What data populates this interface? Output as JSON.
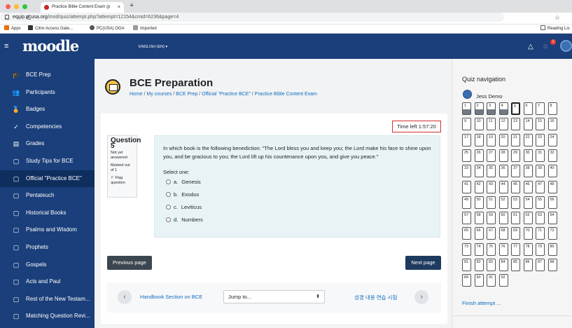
{
  "browser": {
    "tab_title": "Practice Bible Content Exam (p",
    "tab_close": "×",
    "new_tab": "+",
    "url_host": "equip.pcusa.org",
    "url_path": "/mod/quiz/attempt.php?attempt=12154&cmid=6236&page=4",
    "nav_back": "←",
    "nav_forward": "→",
    "nav_reload": "C",
    "star": "☆",
    "bookmarks": [
      "Apps",
      "Citrix Access Gate...",
      "PC(USA) OGA",
      "Imported"
    ],
    "reading_list": "Reading Lis",
    "traffic_colors": [
      "#ff5f57",
      "#febc2e",
      "#28c840"
    ]
  },
  "navbar": {
    "logo": "moodle",
    "language": "ENGLISH (EN) ▾",
    "menu_icon": "≡",
    "bell_icon": "bell-icon",
    "chat_icon": "chat-icon",
    "notification_count": "1",
    "color": "#1a3f7a"
  },
  "sidebar": {
    "items": [
      {
        "label": "BCE Prep",
        "icon": "🎓"
      },
      {
        "label": "Participants",
        "icon": "👥"
      },
      {
        "label": "Badges",
        "icon": "🏅"
      },
      {
        "label": "Competencies",
        "icon": "✓"
      },
      {
        "label": "Grades",
        "icon": "▤"
      },
      {
        "label": "Study Tips for BCE",
        "icon": "▢"
      },
      {
        "label": "Official \"Practice BCE\"",
        "icon": "▢"
      },
      {
        "label": "Pentateuch",
        "icon": "▢"
      },
      {
        "label": "Historical Books",
        "icon": "▢"
      },
      {
        "label": "Psalms and Wisdom",
        "icon": "▢"
      },
      {
        "label": "Prophets",
        "icon": "▢"
      },
      {
        "label": "Gospels",
        "icon": "▢"
      },
      {
        "label": "Acts and Paul",
        "icon": "▢"
      },
      {
        "label": "Rest of the New Testam...",
        "icon": "▢"
      },
      {
        "label": "Matching Question Revi...",
        "icon": "▢"
      }
    ]
  },
  "header": {
    "title": "BCE Preparation",
    "breadcrumb": [
      "Home",
      "My courses",
      "BCE Prep",
      "Official \"Practice BCE\"",
      "Practice Bible Content Exam"
    ]
  },
  "quiz": {
    "time_left": "Time left 1:57:20",
    "question_label": "Question",
    "question_number": "5",
    "status": "Not yet answered",
    "marked_out_of": "Marked out of 1",
    "flag": "⚐ Flag question",
    "question_text": "In which book is the following benediction: \"The Lord bless you and keep you; the Lord make his face to shine upon you, and be gracious to you; the Lord lift up his countenance upon you, and give you peace.\"",
    "select_one": "Select one:",
    "options": [
      {
        "letter": "a.",
        "text": "Genesis"
      },
      {
        "letter": "b.",
        "text": "Exodus"
      },
      {
        "letter": "c.",
        "text": "Leviticus"
      },
      {
        "letter": "d.",
        "text": "Numbers"
      }
    ],
    "previous_page": "Previous page",
    "next_page": "Next page"
  },
  "activity_nav": {
    "prev_activity": "Handbook Section on BCE",
    "jump_to": "Jump to...",
    "next_activity": "성경 내용 연습 시험",
    "prev_arrow": "‹",
    "next_arrow": "›"
  },
  "quiz_nav": {
    "title": "Quiz navigation",
    "user": "Jess Demo",
    "total": 92,
    "answered": [
      1,
      2,
      3,
      4
    ],
    "current": 5,
    "finish": "Finish attempt ..."
  }
}
